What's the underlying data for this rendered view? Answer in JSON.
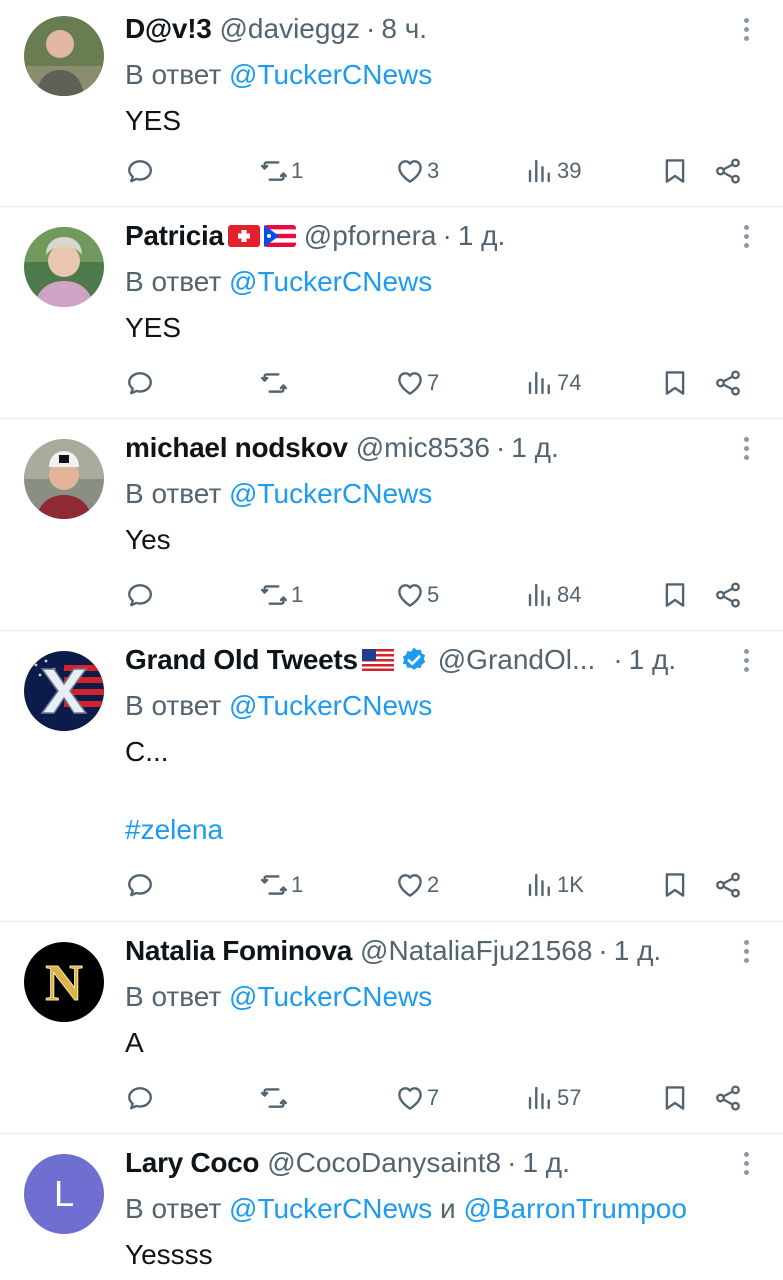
{
  "reply_prefix": "В ответ",
  "tweets": [
    {
      "name": "D@v!3",
      "handle": "@davieggz",
      "separator": "·",
      "time": "8 ч.",
      "reply_to": "@TuckerCNews",
      "text": "YES",
      "replies": "",
      "retweets": "1",
      "likes": "3",
      "views": "39"
    },
    {
      "name": "Patricia",
      "handle": "@pfornera",
      "separator": "·",
      "time": "1 д.",
      "reply_to": "@TuckerCNews",
      "text": "YES",
      "replies": "",
      "retweets": "",
      "likes": "7",
      "views": "74"
    },
    {
      "name": "michael nodskov",
      "handle": "@mic8536",
      "separator": "·",
      "time": "1 д.",
      "reply_to": "@TuckerCNews",
      "text": "Yes",
      "replies": "",
      "retweets": "1",
      "likes": "5",
      "views": "84"
    },
    {
      "name": "Grand Old Tweets",
      "handle": "@GrandOl...",
      "separator": "·",
      "time": "1 д.",
      "reply_to": "@TuckerCNews",
      "text": "C...",
      "hashtag": "#zelena",
      "replies": "",
      "retweets": "1",
      "likes": "2",
      "views": "1K"
    },
    {
      "name": "Natalia Fominova",
      "handle": "@NataliaFju21568",
      "separator": "·",
      "time": "1 д.",
      "reply_to": "@TuckerCNews",
      "text": "A",
      "replies": "",
      "retweets": "",
      "likes": "7",
      "views": "57"
    },
    {
      "name": "Lary Coco",
      "handle": "@CocoDanysaint8",
      "separator": "·",
      "time": "1 д.",
      "reply_to": "@TuckerCNews",
      "reply_conj": "и",
      "reply_to_2": "@BarronTrumpoo",
      "text": "Yessss",
      "avatar_letter": "L"
    }
  ],
  "icons": {
    "reply": "reply-icon",
    "retweet": "retweet-icon",
    "like": "heart-icon",
    "views": "views-icon",
    "bookmark": "bookmark-icon",
    "share": "share-icon",
    "more": "more-vertical-icon"
  },
  "colors": {
    "link": "#1d9bf0",
    "muted": "#536471",
    "text": "#0f1419",
    "divider": "#e7e9ea",
    "avatar_letter_bg": "#6e6fd0"
  }
}
